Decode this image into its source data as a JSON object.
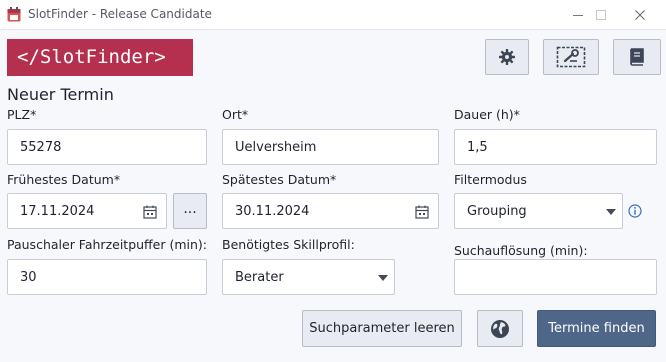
{
  "window": {
    "title": "SlotFinder - Release Candidate",
    "minimize_glyph": "—",
    "maximize_glyph": "☐",
    "close_glyph": "✕"
  },
  "logo": {
    "text": "</SlotFinder>"
  },
  "toolbar": {
    "settings_icon": "gear-icon",
    "tools_icon": "wrench-ticket-icon",
    "docs_icon": "book-icon"
  },
  "form": {
    "title": "Neuer Termin",
    "plz": {
      "label": "PLZ*",
      "value": "55278"
    },
    "ort": {
      "label": "Ort*",
      "value": "Uelversheim"
    },
    "dauer": {
      "label": "Dauer (h)*",
      "value": "1,5"
    },
    "fruehestes_datum": {
      "label": "Frühestes Datum*",
      "value": "17.11.2024"
    },
    "dots_button": "...",
    "spaetestes_datum": {
      "label": "Spätestes Datum*",
      "value": "30.11.2024"
    },
    "filtermodus": {
      "label": "Filtermodus",
      "value": "Grouping"
    },
    "fahrzeitpuffer": {
      "label": "Pauschaler Fahrzeitpuffer (min):",
      "value": "30"
    },
    "skillprofil": {
      "label": "Benötigtes Skillprofil:",
      "value": "Berater"
    },
    "suchaufloesung": {
      "label": "Suchauflösung (min):",
      "value": ""
    }
  },
  "actions": {
    "clear_label": "Suchparameter leeren",
    "find_label": "Termine finden"
  },
  "colors": {
    "brand": "#b5304f",
    "primary_button": "#4e6687",
    "background": "#f7f8fb"
  }
}
